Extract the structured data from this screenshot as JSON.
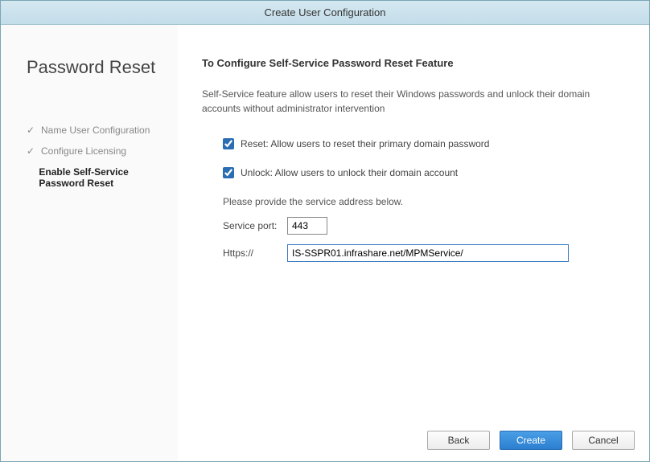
{
  "window": {
    "title": "Create User Configuration"
  },
  "sidebar": {
    "title": "Password Reset",
    "steps": [
      {
        "label": "Name User Configuration",
        "done": true
      },
      {
        "label": "Configure Licensing",
        "done": true
      },
      {
        "label": "Enable Self-Service Password Reset",
        "done": false
      }
    ]
  },
  "main": {
    "heading": "To Configure Self-Service Password Reset Feature",
    "description": "Self-Service feature allow users to reset their Windows passwords and unlock their domain accounts without administrator intervention",
    "reset_label": "Reset: Allow users to reset their primary domain password",
    "reset_checked": true,
    "unlock_label": "Unlock: Allow users to unlock their domain account",
    "unlock_checked": true,
    "address_instruction": "Please provide the service address below.",
    "port_label": "Service port:",
    "port_value": "443",
    "https_label": "Https://",
    "https_value": "IS-SSPR01.infrashare.net/MPMService/"
  },
  "buttons": {
    "back": "Back",
    "create": "Create",
    "cancel": "Cancel"
  }
}
